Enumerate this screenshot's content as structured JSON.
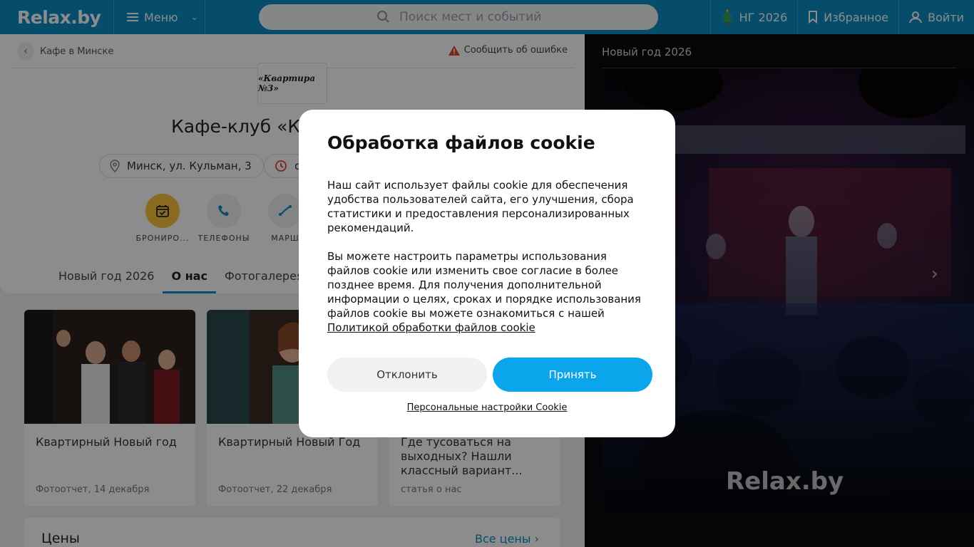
{
  "header": {
    "logo": "Relax.by",
    "menu_label": "Меню",
    "search_placeholder": "Поиск мест и событий",
    "ny_label": "НГ 2026",
    "favorites_label": "Избранное",
    "login_label": "Войти"
  },
  "breadcrumb": {
    "label": "Кафе в Минске"
  },
  "report_label": "Сообщить об ошибке",
  "place": {
    "logo_text": "«Квартира №3»",
    "title": "Кафе-клуб «Кв",
    "address": "Минск, ул. Кульман, 3",
    "hours_partial": "с"
  },
  "actions": [
    {
      "label": "БРОНИРО...",
      "icon": "calendar-check-icon"
    },
    {
      "label": "ТЕЛЕФОНЫ",
      "icon": "phone-icon"
    },
    {
      "label": "МАРШ",
      "icon": "route-icon"
    }
  ],
  "tabs": [
    {
      "label": "Новый год 2026"
    },
    {
      "label": "О нас"
    },
    {
      "label": "Фотогалерея"
    }
  ],
  "tiles": [
    {
      "title": "Квартирный Новый год",
      "meta": "Фотоотчет, 14 декабря"
    },
    {
      "title": "Квартирный Новый Год",
      "meta": "Фотоотчет, 22 декабря"
    },
    {
      "title": "Где тусоваться на выходных? Нашли классный вариант...",
      "meta": "статья о нас"
    }
  ],
  "prices": {
    "title": "Цены",
    "link": "Все цены"
  },
  "right_panel": {
    "title": "Новый год 2026",
    "watermark": "Relax.by"
  },
  "cookie": {
    "title": "Обработка файлов cookie",
    "p1": "Наш сайт использует файлы cookie для обеспечения удобства пользователей сайта, его улучшения, сбора статистики и предоставления персонализированных рекомендаций.",
    "p2": "Вы можете настроить параметры использования файлов cookie или изменить свое согласие в более позднее время. Для получения дополнительной информации о целях, сроках и порядке использования файлов cookie вы можете ознакомиться с нашей",
    "policy_link": "Политикой обработки файлов cookie",
    "decline": "Отклонить",
    "accept": "Принять",
    "settings_link": "Персональные настройки Cookie"
  },
  "colors": {
    "brand": "#0b8bc4",
    "accept": "#0aa5ea",
    "booking": "#f7c23b"
  }
}
